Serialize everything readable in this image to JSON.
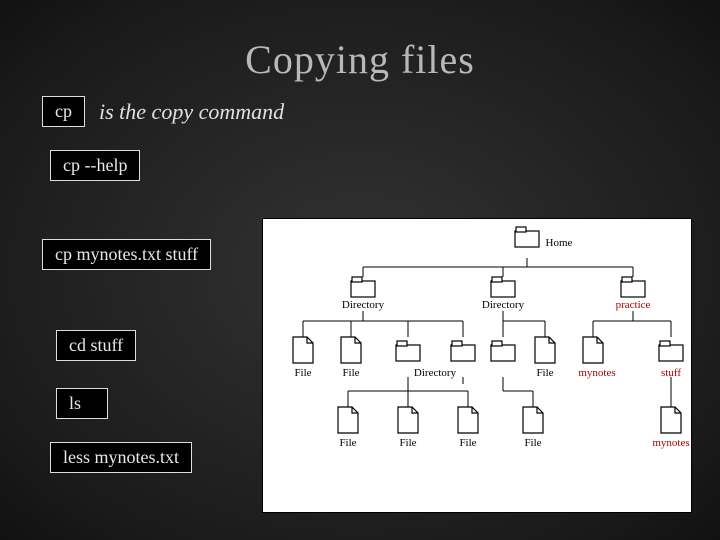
{
  "title": "Copying files",
  "line1_cmd": "cp",
  "line1_desc": "is the copy command",
  "cmd2": "cp  --help",
  "cmd3": "cp  mynotes.txt  stuff",
  "cmd4": "cd stuff",
  "cmd5": "ls",
  "cmd6": "less  mynotes.txt",
  "labels": {
    "home": "Home",
    "dir1": "Directory",
    "dir2": "Directory",
    "practice": "practice",
    "file_a": "File",
    "file_b": "File",
    "dir3": "Directory",
    "file_c": "File",
    "mynotes": "mynotes",
    "stuff": "stuff",
    "file_d": "File",
    "file_e": "File",
    "file_f": "File",
    "file_g": "File",
    "mynotes2": "mynotes"
  }
}
